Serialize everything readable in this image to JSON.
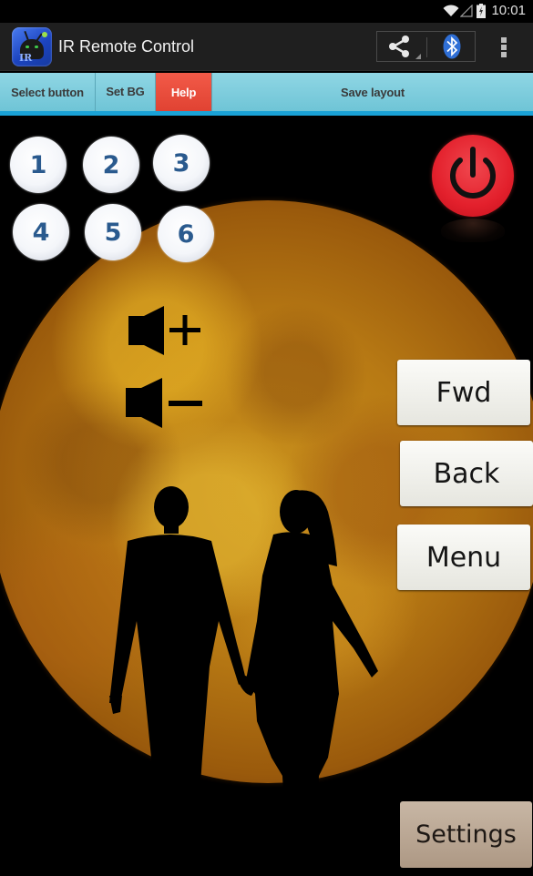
{
  "status_bar": {
    "time": "10:01",
    "icons": [
      "wifi-icon",
      "cell-signal-icon",
      "battery-charging-icon"
    ]
  },
  "action_bar": {
    "app_icon": "ir-remote-app-icon",
    "app_icon_text": "IR",
    "title": "IR Remote Control",
    "actions": [
      {
        "name": "share",
        "icon": "share-icon"
      },
      {
        "name": "bluetooth",
        "icon": "bluetooth-icon"
      },
      {
        "name": "overflow",
        "icon": "overflow-menu-icon"
      }
    ]
  },
  "toolbar": {
    "select_button": "Select button",
    "set_bg": "Set BG",
    "help": "Help",
    "save_layout": "Save layout"
  },
  "remote": {
    "number_buttons": [
      "1",
      "2",
      "3",
      "4",
      "5",
      "6"
    ],
    "power": "power-icon",
    "volume_up": "volume-up-icon",
    "volume_down": "volume-down-icon",
    "fwd": "Fwd",
    "back": "Back",
    "menu": "Menu",
    "settings": "Settings"
  },
  "colors": {
    "toolbar_bg": "#7fcfe0",
    "help_bg": "#e84c3c",
    "accent_underline": "#1aa2d6",
    "number_text": "#2a5a8e",
    "power_red": "#e3202c",
    "moon": "#b87a14"
  }
}
